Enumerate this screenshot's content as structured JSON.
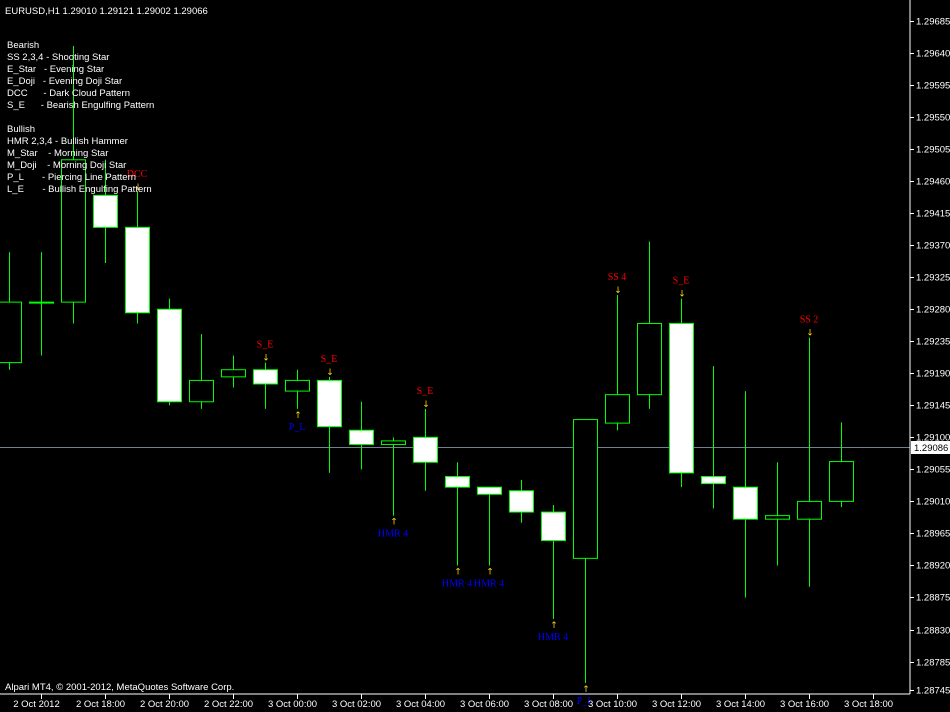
{
  "chart_header": "EURUSD,H1  1.29010 1.29121 1.29002 1.29066",
  "legend": {
    "bearish_title": "Bearish",
    "bearish_items": [
      "SS 2,3,4 - Shooting Star",
      "E_Star   - Evening Star",
      "E_Doji   - Evening Doji Star",
      "DCC      - Dark Cloud Pattern",
      "S_E      - Bearish Engulfing Pattern"
    ],
    "bullish_title": "Bullish",
    "bullish_items": [
      "HMR 2,3,4 - Bullish Hammer",
      "M_Star    - Morning Star",
      "M_Doji    - Morning Doji Star",
      "P_L       - Piercing Line Pattern",
      "L_E       - Bullish Engulfing Pattern"
    ]
  },
  "copyright": "Alpari MT4, © 2001-2012, MetaQuotes Software Corp.",
  "current_price_label": "1.29086",
  "colors": {
    "background": "#000000",
    "candle_outline": "#00ff00",
    "bull_fill": "#000000",
    "bear_fill": "#ffffff",
    "bearish_label": "#ff0000",
    "bullish_label": "#0000ff",
    "arrow": "#ffd800",
    "price_line": "#708090",
    "text": "#ffffff"
  },
  "chart_data": {
    "type": "candlestick",
    "symbol": "EURUSD",
    "timeframe": "H1",
    "ylim": [
      1.28745,
      1.29685
    ],
    "y_ticks": [
      "1.29685",
      "1.29640",
      "1.29595",
      "1.29550",
      "1.29505",
      "1.29460",
      "1.29415",
      "1.29370",
      "1.29325",
      "1.29280",
      "1.29235",
      "1.29190",
      "1.29145",
      "1.29100",
      "1.29055",
      "1.29010",
      "1.28965",
      "1.28920",
      "1.28875",
      "1.28830",
      "1.28785",
      "1.28745"
    ],
    "x_ticks": [
      {
        "index": 1,
        "label": "2 Oct 2012"
      },
      {
        "index": 3,
        "label": "2 Oct 18:00"
      },
      {
        "index": 5,
        "label": "2 Oct 20:00"
      },
      {
        "index": 7,
        "label": "2 Oct 22:00"
      },
      {
        "index": 9,
        "label": "3 Oct 00:00"
      },
      {
        "index": 11,
        "label": "3 Oct 02:00"
      },
      {
        "index": 13,
        "label": "3 Oct 04:00"
      },
      {
        "index": 15,
        "label": "3 Oct 06:00"
      },
      {
        "index": 17,
        "label": "3 Oct 08:00"
      },
      {
        "index": 19,
        "label": "3 Oct 10:00"
      },
      {
        "index": 21,
        "label": "3 Oct 12:00"
      },
      {
        "index": 23,
        "label": "3 Oct 14:00"
      },
      {
        "index": 25,
        "label": "3 Oct 16:00"
      },
      {
        "index": 27,
        "label": "3 Oct 18:00"
      }
    ],
    "candles": [
      {
        "o": 1.29205,
        "h": 1.2936,
        "l": 1.29195,
        "c": 1.2929
      },
      {
        "o": 1.2929,
        "h": 1.2936,
        "l": 1.29215,
        "c": 1.2929
      },
      {
        "o": 1.2929,
        "h": 1.2965,
        "l": 1.2926,
        "c": 1.2949
      },
      {
        "o": 1.2944,
        "h": 1.2949,
        "l": 1.29345,
        "c": 1.29395
      },
      {
        "o": 1.29395,
        "h": 1.29445,
        "l": 1.2926,
        "c": 1.29275
      },
      {
        "o": 1.2928,
        "h": 1.29295,
        "l": 1.29145,
        "c": 1.2915
      },
      {
        "o": 1.2915,
        "h": 1.29245,
        "l": 1.2914,
        "c": 1.2918
      },
      {
        "o": 1.29185,
        "h": 1.29215,
        "l": 1.2917,
        "c": 1.29195
      },
      {
        "o": 1.29195,
        "h": 1.29205,
        "l": 1.2914,
        "c": 1.29175
      },
      {
        "o": 1.29165,
        "h": 1.29195,
        "l": 1.2914,
        "c": 1.2918
      },
      {
        "o": 1.2918,
        "h": 1.29185,
        "l": 1.2905,
        "c": 1.29115
      },
      {
        "o": 1.2911,
        "h": 1.2915,
        "l": 1.29055,
        "c": 1.2909
      },
      {
        "o": 1.2909,
        "h": 1.291,
        "l": 1.2899,
        "c": 1.29095
      },
      {
        "o": 1.291,
        "h": 1.2914,
        "l": 1.29025,
        "c": 1.29065
      },
      {
        "o": 1.29045,
        "h": 1.29065,
        "l": 1.2892,
        "c": 1.2903
      },
      {
        "o": 1.2903,
        "h": 1.2903,
        "l": 1.2892,
        "c": 1.2902
      },
      {
        "o": 1.29025,
        "h": 1.2904,
        "l": 1.2898,
        "c": 1.28995
      },
      {
        "o": 1.28995,
        "h": 1.29005,
        "l": 1.28845,
        "c": 1.28955
      },
      {
        "o": 1.2893,
        "h": 1.2899,
        "l": 1.28755,
        "c": 1.29125
      },
      {
        "o": 1.2912,
        "h": 1.293,
        "l": 1.2911,
        "c": 1.2916
      },
      {
        "o": 1.2916,
        "h": 1.29375,
        "l": 1.2914,
        "c": 1.2926
      },
      {
        "o": 1.2926,
        "h": 1.29295,
        "l": 1.2903,
        "c": 1.2905
      },
      {
        "o": 1.29045,
        "h": 1.292,
        "l": 1.29,
        "c": 1.29035
      },
      {
        "o": 1.2903,
        "h": 1.29165,
        "l": 1.28875,
        "c": 1.28985
      },
      {
        "o": 1.28985,
        "h": 1.29065,
        "l": 1.2892,
        "c": 1.2899
      },
      {
        "o": 1.28985,
        "h": 1.2924,
        "l": 1.2889,
        "c": 1.2901
      },
      {
        "o": 1.2901,
        "h": 1.29121,
        "l": 1.29002,
        "c": 1.29066
      }
    ],
    "current_price": 1.29086,
    "markers": [
      {
        "index": 4,
        "label": "DCC",
        "type": "bearish"
      },
      {
        "index": 8,
        "label": "S_E",
        "type": "bearish"
      },
      {
        "index": 9,
        "label": "P_L",
        "type": "bullish"
      },
      {
        "index": 10,
        "label": "S_E",
        "type": "bearish"
      },
      {
        "index": 12,
        "label": "HMR 4",
        "type": "bullish"
      },
      {
        "index": 13,
        "label": "S_E",
        "type": "bearish"
      },
      {
        "index": 14,
        "label": "HMR 4",
        "type": "bullish"
      },
      {
        "index": 15,
        "label": "HMR 4",
        "type": "bullish"
      },
      {
        "index": 17,
        "label": "HMR 4",
        "type": "bullish"
      },
      {
        "index": 18,
        "label": "P_L",
        "type": "bullish"
      },
      {
        "index": 19,
        "label": "SS 4",
        "type": "bearish"
      },
      {
        "index": 21,
        "label": "S_E",
        "type": "bearish"
      },
      {
        "index": 25,
        "label": "SS 2",
        "type": "bearish"
      }
    ]
  }
}
